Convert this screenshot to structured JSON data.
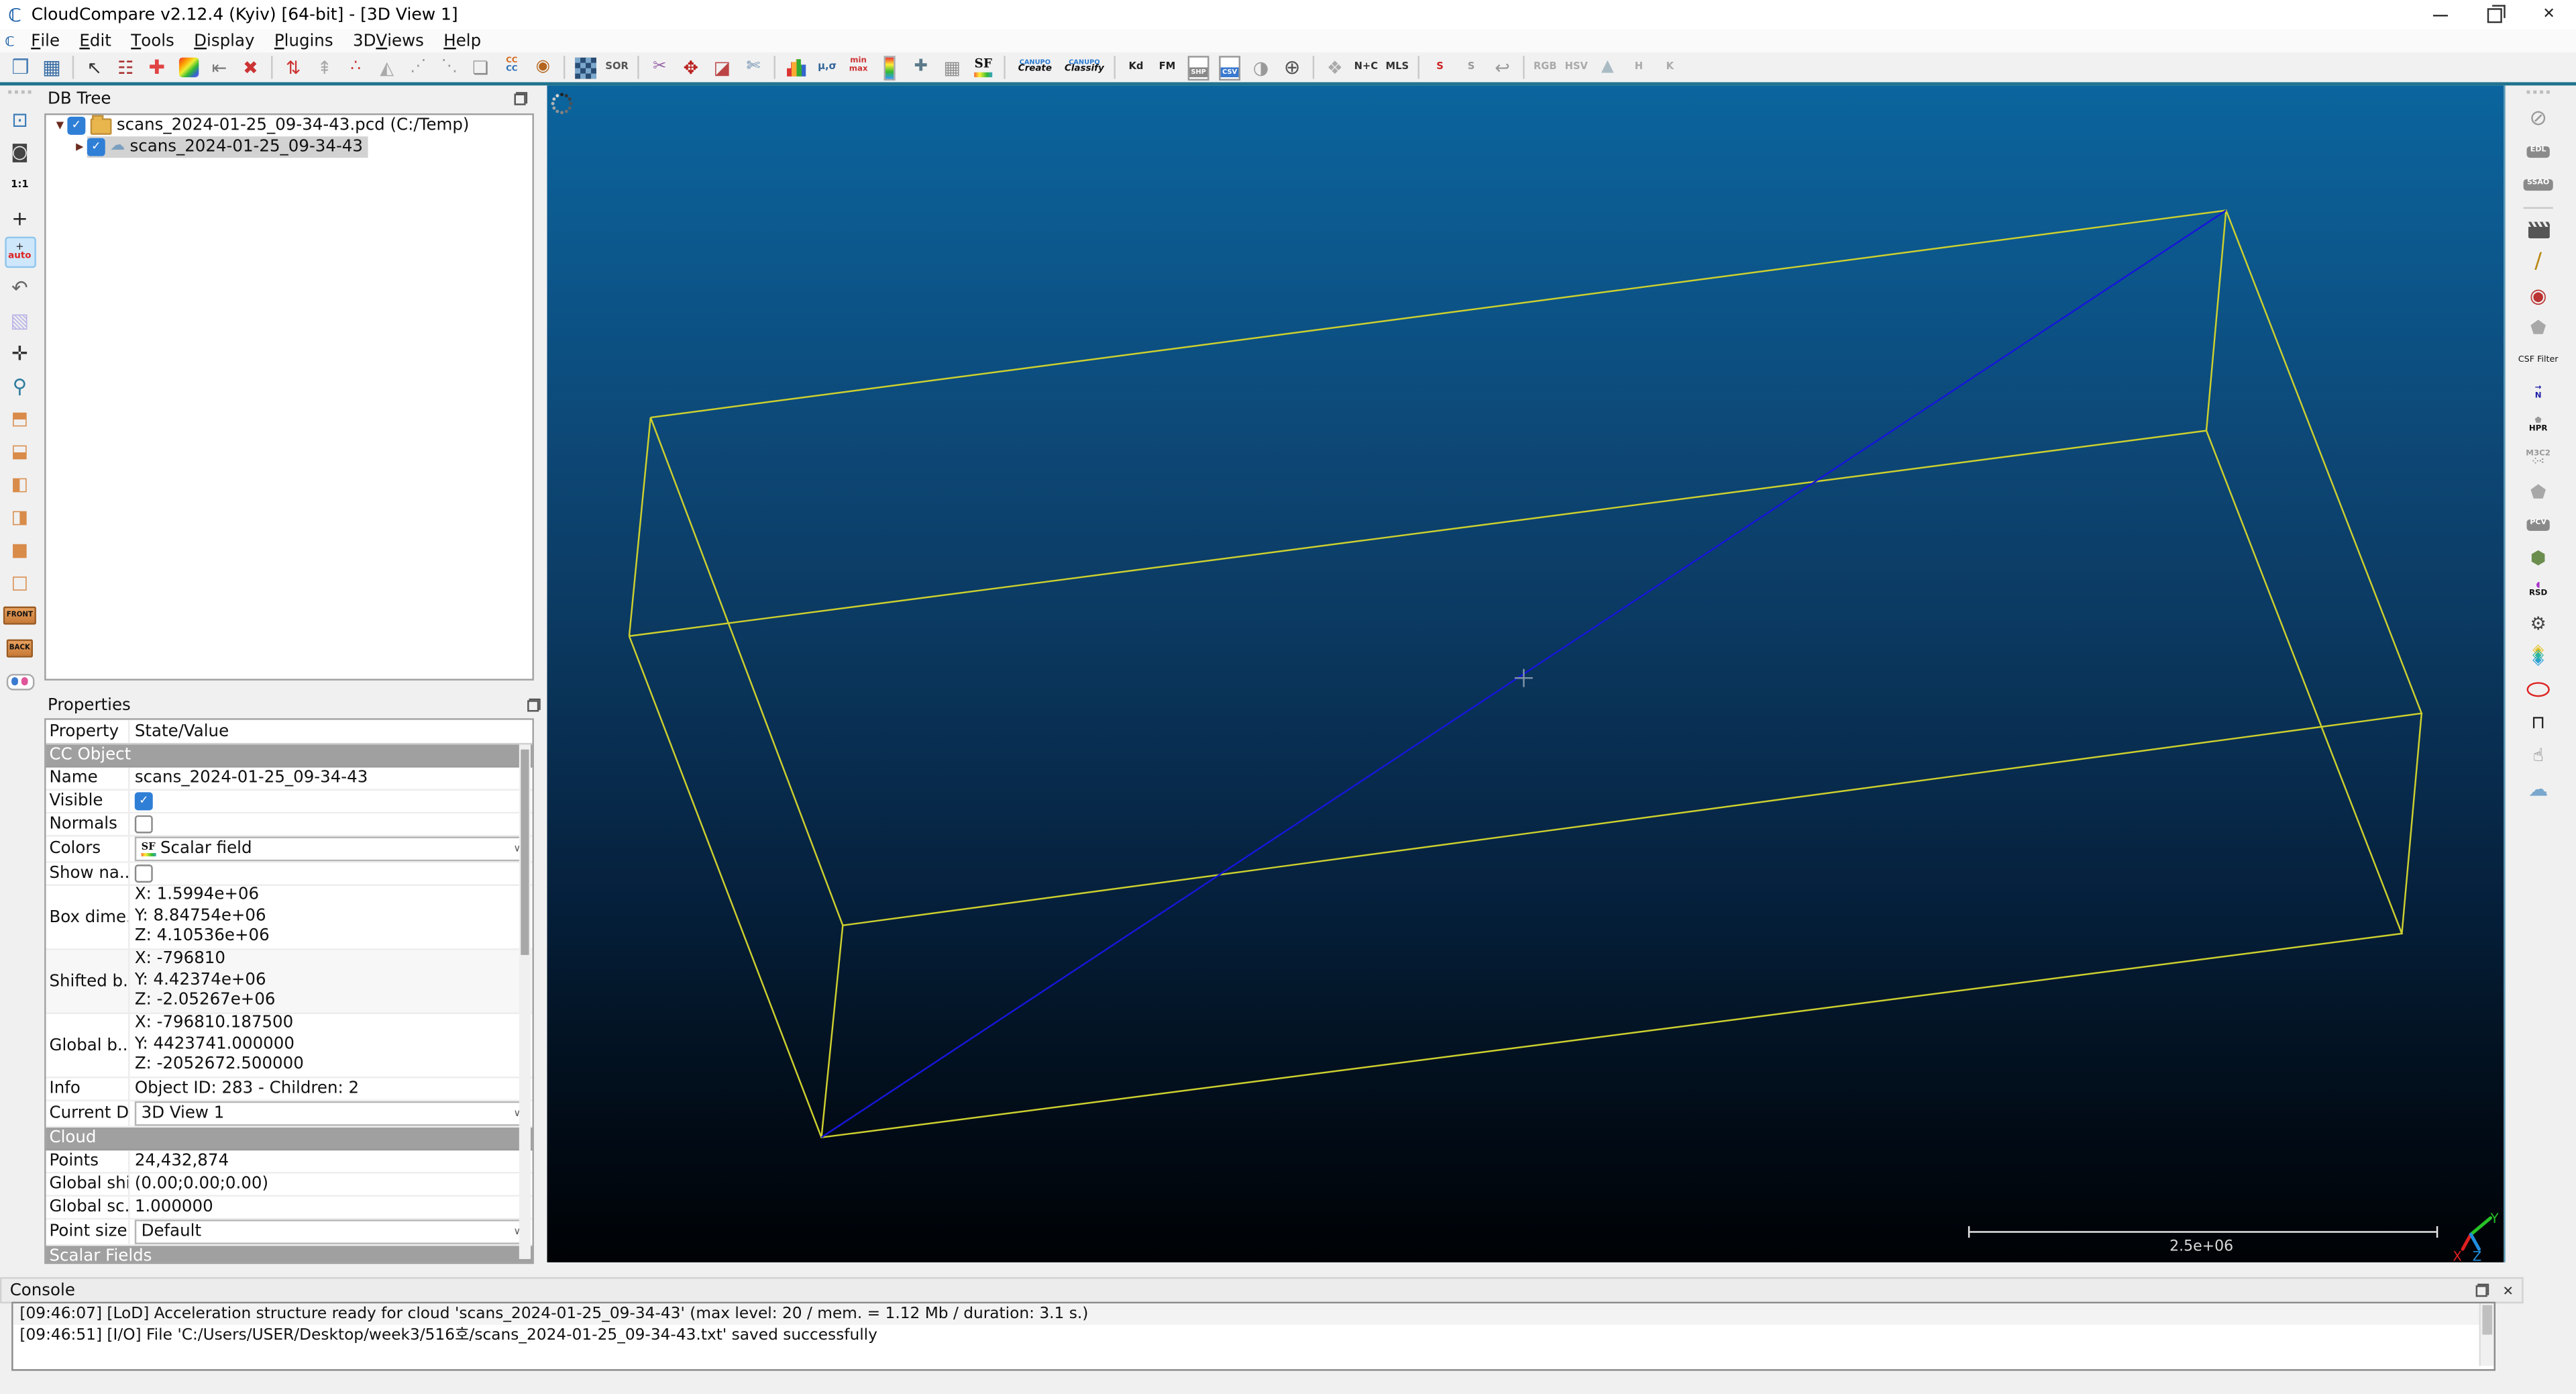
{
  "window": {
    "title": "CloudCompare v2.12.4 (Kyiv) [64-bit] - [3D View 1]",
    "logo": "ℂ",
    "controls": {
      "minimize": "minimize",
      "restore": "restore",
      "close": "✕"
    }
  },
  "menu": {
    "items": [
      {
        "label": "File",
        "u": 0
      },
      {
        "label": "Edit",
        "u": 0
      },
      {
        "label": "Tools",
        "u": 0
      },
      {
        "label": "Display",
        "u": 0
      },
      {
        "label": "Plugins",
        "u": 0
      },
      {
        "label": "3D Views",
        "u": 3
      },
      {
        "label": "Help",
        "u": 0
      }
    ]
  },
  "toolbar_top": {
    "items": [
      {
        "name": "open",
        "kind": "g",
        "glyph": "❒",
        "color": "#4a7fb5",
        "size": 12
      },
      {
        "name": "save",
        "kind": "g",
        "glyph": "▦",
        "color": "#3a6ea5",
        "size": 12
      },
      {
        "sep": true
      },
      {
        "name": "pick-element",
        "kind": "g",
        "glyph": "↖",
        "color": "#333",
        "size": 11
      },
      {
        "name": "properties-list",
        "kind": "g",
        "glyph": "☷",
        "color": "#a33",
        "size": 11
      },
      {
        "name": "add-point-pair",
        "kind": "g",
        "glyph": "✚",
        "color": "#e04343",
        "size": 12
      },
      {
        "name": "interpolate-colors",
        "kind": "rainbow"
      },
      {
        "name": "apply-transformation",
        "kind": "g",
        "glyph": "⇤",
        "color": "#777",
        "size": 11
      },
      {
        "name": "delete-entity",
        "kind": "g",
        "glyph": "✖",
        "color": "#c33",
        "size": 11
      },
      {
        "sep": true
      },
      {
        "name": "translate-rotate-entity",
        "kind": "g",
        "glyph": "⇅",
        "color": "#c33",
        "size": 11
      },
      {
        "name": "compute-normals",
        "kind": "g",
        "glyph": "⇞",
        "color": "#aaa",
        "size": 11
      },
      {
        "name": "octree-points",
        "kind": "g",
        "glyph": "∴",
        "color": "#c33",
        "size": 10
      },
      {
        "name": "compute-mesh",
        "kind": "g",
        "glyph": "◭",
        "color": "#aaa",
        "size": 11
      },
      {
        "name": "sample-points-a",
        "kind": "g",
        "glyph": "⋰",
        "color": "#999",
        "size": 10
      },
      {
        "name": "sample-points-b",
        "kind": "g",
        "glyph": "⋱",
        "color": "#999",
        "size": 10
      },
      {
        "name": "inspect-cloud",
        "kind": "g",
        "glyph": "❏",
        "color": "#888",
        "size": 11
      },
      {
        "name": "cloud-cloud-compare",
        "kind": "two",
        "t1": "CC",
        "t2": "CC",
        "c1": "#d2691e",
        "c2": "#2a6db5"
      },
      {
        "name": "point-glove",
        "kind": "g",
        "glyph": "◉",
        "color": "#b5651d",
        "size": 10
      },
      {
        "sep": true
      },
      {
        "name": "subsample",
        "kind": "checker"
      },
      {
        "name": "sor-filter",
        "kind": "txt",
        "text": "SOR",
        "color": "#555"
      },
      {
        "sep": true
      },
      {
        "name": "scissors-segment",
        "kind": "g",
        "glyph": "✂",
        "color": "#9966aa",
        "size": 10
      },
      {
        "name": "translate-rotate-tool",
        "kind": "g",
        "glyph": "✥",
        "color": "#b22",
        "size": 11
      },
      {
        "name": "cross-section",
        "kind": "g",
        "glyph": "◪",
        "color": "#b44",
        "size": 11
      },
      {
        "name": "segment-cut",
        "kind": "g",
        "glyph": "✄",
        "color": "#6688aa",
        "size": 10
      },
      {
        "sep": true
      },
      {
        "name": "sf-histogram",
        "kind": "hist"
      },
      {
        "name": "sf-statistics",
        "kind": "txt",
        "text": "µ,σ",
        "color": "#336699"
      },
      {
        "name": "sf-minmax",
        "kind": "two",
        "t1": "min",
        "t2": "max",
        "c1": "#c33",
        "c2": "#c33"
      },
      {
        "name": "sf-delete-colorbar",
        "kind": "cbar"
      },
      {
        "name": "sf-add",
        "kind": "g",
        "glyph": "✚",
        "color": "#5a7a8a",
        "size": 10
      },
      {
        "name": "sf-calculator",
        "kind": "g",
        "glyph": "▦",
        "color": "#909090",
        "size": 11
      },
      {
        "name": "sf-color-scale",
        "kind": "sf"
      },
      {
        "sep": true
      },
      {
        "name": "canupo-create",
        "kind": "canupo",
        "t1": "CANUPO",
        "t2": "Create"
      },
      {
        "name": "canupo-classify",
        "kind": "canupo",
        "t1": "CANUPO",
        "t2": "Classify"
      },
      {
        "sep": true
      },
      {
        "name": "kd-tree",
        "kind": "txt",
        "text": "Kd",
        "color": "#222"
      },
      {
        "name": "fm-tool",
        "kind": "txt",
        "text": "FM",
        "color": "#222"
      },
      {
        "name": "shp-export",
        "kind": "doc",
        "text": "SHP",
        "blue": false
      },
      {
        "name": "csv-export",
        "kind": "doc",
        "text": "CSV",
        "blue": true
      },
      {
        "name": "sphere-tool",
        "kind": "g",
        "glyph": "◑",
        "color": "#999",
        "size": 11
      },
      {
        "name": "globe-projection",
        "kind": "g",
        "glyph": "⊕",
        "color": "#555",
        "size": 12
      },
      {
        "sep": true
      },
      {
        "name": "puzzle-plugin",
        "kind": "g",
        "glyph": "❖",
        "color": "#aaa",
        "size": 11
      },
      {
        "name": "normals-curvature",
        "kind": "txt",
        "text": "N+C",
        "color": "#333"
      },
      {
        "name": "mls-smoothing",
        "kind": "txt",
        "text": "MLS",
        "color": "#333"
      },
      {
        "sep": true
      },
      {
        "name": "spline-red",
        "kind": "txt",
        "text": "S",
        "color": "#c22"
      },
      {
        "name": "spline-points",
        "kind": "txt",
        "text": "S",
        "color": "#999"
      },
      {
        "name": "unroll-cylinder",
        "kind": "g",
        "glyph": "↩",
        "color": "#999",
        "size": 11
      },
      {
        "sep": true
      },
      {
        "name": "rgb-filter",
        "kind": "txt",
        "text": "RGB",
        "color": "#aaa"
      },
      {
        "name": "hsv-filter",
        "kind": "txt",
        "text": "HSV",
        "color": "#aaa"
      },
      {
        "name": "mountain-arrow",
        "kind": "g",
        "glyph": "▲",
        "color": "#aabbc4",
        "size": 10
      },
      {
        "name": "h-filter",
        "kind": "txt",
        "text": "H",
        "color": "#aaa"
      },
      {
        "name": "k-filter",
        "kind": "txt",
        "text": "K",
        "color": "#aaa"
      }
    ]
  },
  "toolbar_left": {
    "items": [
      {
        "name": "display-options",
        "kind": "g",
        "glyph": "⊡",
        "color": "#3b7bb8",
        "size": 12
      },
      {
        "name": "screenshot-camera",
        "kind": "g",
        "glyph": "◙",
        "color": "#444",
        "size": 11
      },
      {
        "name": "zoom-1-1",
        "kind": "txt",
        "text": "1:1",
        "color": "#111"
      },
      {
        "name": "pick-rotation-center",
        "kind": "g",
        "glyph": "+",
        "color": "#222",
        "size": 12
      },
      {
        "name": "auto-pick-center",
        "kind": "auto",
        "t1": "+",
        "t2": "auto",
        "active": true
      },
      {
        "name": "set-current-view",
        "kind": "g",
        "glyph": "↶",
        "color": "#666",
        "size": 12
      },
      {
        "name": "perspective-cube",
        "kind": "g",
        "glyph": "▧",
        "color": "#b9b3e6",
        "size": 12
      },
      {
        "name": "pan-mode",
        "kind": "g",
        "glyph": "✛",
        "color": "#333",
        "size": 12
      },
      {
        "name": "zoom-lens",
        "kind": "g",
        "glyph": "⚲",
        "color": "#2e7d9e",
        "size": 12
      },
      {
        "name": "view-top",
        "kind": "g",
        "glyph": "⬒",
        "color": "#d98b4a",
        "size": 11
      },
      {
        "name": "view-front",
        "kind": "g",
        "glyph": "⬓",
        "color": "#d98b4a",
        "size": 11
      },
      {
        "name": "view-left",
        "kind": "g",
        "glyph": "◧",
        "color": "#d98b4a",
        "size": 11
      },
      {
        "name": "view-back",
        "kind": "g",
        "glyph": "◨",
        "color": "#d98b4a",
        "size": 11
      },
      {
        "name": "view-right",
        "kind": "g",
        "glyph": "■",
        "color": "#d98b4a",
        "size": 11
      },
      {
        "name": "view-bottom",
        "kind": "g",
        "glyph": "□",
        "color": "#d98b4a",
        "size": 11
      },
      {
        "name": "view-front-label",
        "kind": "fb",
        "text": "FRONT"
      },
      {
        "name": "view-back-label",
        "kind": "fb",
        "text": "BACK"
      },
      {
        "name": "stereo-glasses",
        "kind": "glasses",
        "c1": "#3a7ad0",
        "c2": "#e0559a"
      }
    ]
  },
  "toolbar_right": {
    "items": [
      {
        "name": "no-filter",
        "kind": "g",
        "glyph": "⊘",
        "color": "#9a9a9a",
        "size": 13
      },
      {
        "name": "edl-filter",
        "kind": "badge",
        "text": "EDL"
      },
      {
        "name": "ssao-filter",
        "kind": "badge",
        "text": "SSAO"
      },
      {
        "sep": true
      },
      {
        "name": "animation",
        "kind": "clap"
      },
      {
        "name": "clean-broom",
        "kind": "g",
        "glyph": "∕",
        "color": "#b8860b",
        "size": 13
      },
      {
        "name": "compass",
        "kind": "g",
        "glyph": "◉",
        "color": "#b33",
        "size": 12
      },
      {
        "name": "shield-a",
        "kind": "g",
        "glyph": "⬟",
        "color": "#a8a8a8",
        "size": 11
      },
      {
        "name": "csf-filter",
        "kind": "lbl",
        "text": "CSF Filter"
      },
      {
        "name": "normals-n",
        "kind": "two",
        "t1": "→",
        "t2": "N",
        "c1": "#2222aa",
        "c2": "#2222aa"
      },
      {
        "name": "hpr",
        "kind": "two",
        "t1": "⬟",
        "t2": "HPR",
        "c1": "#999",
        "c2": "#111"
      },
      {
        "name": "m3c2",
        "kind": "two",
        "t1": "M3C2",
        "t2": "⁘⁖",
        "c1": "#999",
        "c2": "#888"
      },
      {
        "name": "shield-b",
        "kind": "g",
        "glyph": "⬟",
        "color": "#a8a8a8",
        "size": 11
      },
      {
        "name": "pcv",
        "kind": "badge",
        "text": "PCV"
      },
      {
        "name": "facets",
        "kind": "g",
        "glyph": "⬢",
        "color": "#6b8e4e",
        "size": 11
      },
      {
        "name": "rsd",
        "kind": "two",
        "t1": "◖",
        "t2": "RSD",
        "c1": "#aa33cc",
        "c2": "#111"
      },
      {
        "name": "gears",
        "kind": "g",
        "glyph": "⚙",
        "color": "#444",
        "size": 11
      },
      {
        "name": "layers",
        "kind": "layers",
        "glyph": "◈"
      },
      {
        "name": "red-ellipse",
        "kind": "ellipse"
      },
      {
        "name": "clamp",
        "kind": "g",
        "glyph": "⊓",
        "color": "#222",
        "size": 11
      },
      {
        "name": "hand-picker",
        "kind": "g",
        "glyph": "☝",
        "color": "#666",
        "size": 11
      },
      {
        "name": "cloud-ruler",
        "kind": "g",
        "glyph": "☁",
        "color": "#7aa7cc",
        "size": 12
      }
    ]
  },
  "db_tree": {
    "title": "DB Tree",
    "items": [
      {
        "label": "scans_2024-01-25_09-34-43.pcd (C:/Temp)",
        "arrow": "▼",
        "icon": "folder",
        "checked": true,
        "selected": false,
        "indent": 0
      },
      {
        "label": "scans_2024-01-25_09-34-43",
        "arrow": "▶",
        "icon": "cloud",
        "checked": true,
        "selected": true,
        "indent": 1
      }
    ]
  },
  "properties": {
    "title": "Properties",
    "columns": [
      "Property",
      "State/Value"
    ],
    "rows": [
      {
        "type": "sec",
        "label": "CC Object"
      },
      {
        "type": "text",
        "label": "Name",
        "value": "scans_2024-01-25_09-34-43"
      },
      {
        "type": "check",
        "label": "Visible",
        "checked": true
      },
      {
        "type": "check",
        "label": "Normals",
        "checked": false
      },
      {
        "type": "drop",
        "label": "Colors",
        "value": "Scalar field",
        "icon": "sf"
      },
      {
        "type": "check",
        "label": "Show na...",
        "checked": false
      },
      {
        "type": "triple",
        "label": "Box dime...",
        "values": [
          "X: 1.5994e+06",
          "Y: 8.84754e+06",
          "Z: 4.10536e+06"
        ],
        "shaded": false
      },
      {
        "type": "triple",
        "label": "Shifted b...",
        "values": [
          "X: -796810",
          "Y: 4.42374e+06",
          "Z: -2.05267e+06"
        ],
        "shaded": true
      },
      {
        "type": "triple",
        "label": "Global b...",
        "values": [
          "X: -796810.187500",
          "Y: 4423741.000000",
          "Z: -2052672.500000"
        ],
        "shaded": false
      },
      {
        "type": "text",
        "label": "Info",
        "value": "Object ID: 283 - Children: 2"
      },
      {
        "type": "drop",
        "label": "Current D...",
        "value": "3D View 1"
      },
      {
        "type": "sec",
        "label": "Cloud"
      },
      {
        "type": "text",
        "label": "Points",
        "value": "24,432,874"
      },
      {
        "type": "text",
        "label": "Global shift",
        "value": "(0.00;0.00;0.00)"
      },
      {
        "type": "text",
        "label": "Global sc...",
        "value": "1.000000"
      },
      {
        "type": "drop",
        "label": "Point size",
        "value": "Default"
      },
      {
        "type": "sec",
        "label": "Scalar Fields"
      }
    ]
  },
  "view3d": {
    "scale_label": "2.5e+06",
    "axis_labels": {
      "x": "X",
      "y": "Y",
      "z": "Z"
    },
    "axis_colors": {
      "x": "#e02020",
      "y": "#27c327",
      "z": "#2090e0"
    },
    "wireframe": {
      "color": "#cdd02e",
      "diagonal_color": "#1616d9",
      "edges": [
        [
          [
            63,
            202
          ],
          [
            1022,
            76
          ],
          [
            1141,
            382
          ],
          [
            180,
            511
          ],
          [
            63,
            202
          ]
        ],
        [
          [
            50,
            335
          ],
          [
            1010,
            210
          ],
          [
            1129,
            516
          ],
          [
            167,
            640
          ],
          [
            50,
            335
          ]
        ],
        [
          [
            63,
            202
          ],
          [
            50,
            335
          ]
        ],
        [
          [
            1022,
            76
          ],
          [
            1010,
            210
          ]
        ],
        [
          [
            1141,
            382
          ],
          [
            1129,
            516
          ]
        ],
        [
          [
            180,
            511
          ],
          [
            167,
            640
          ]
        ]
      ],
      "diagonal": [
        [
          1022,
          76
        ],
        [
          167,
          640
        ]
      ]
    }
  },
  "console": {
    "title": "Console",
    "lines": [
      {
        "text": "[09:46:07] [LoD] Acceleration structure ready for cloud 'scans_2024-01-25_09-34-43' (max level: 20 / mem. = 1.12 Mb / duration: 3.1 s.)",
        "alt": true
      },
      {
        "text": "[09:46:51] [I/O] File 'C:/Users/USER/Desktop/week3/516호/scans_2024-01-25_09-34-43.txt' saved successfully",
        "alt": false
      }
    ]
  }
}
